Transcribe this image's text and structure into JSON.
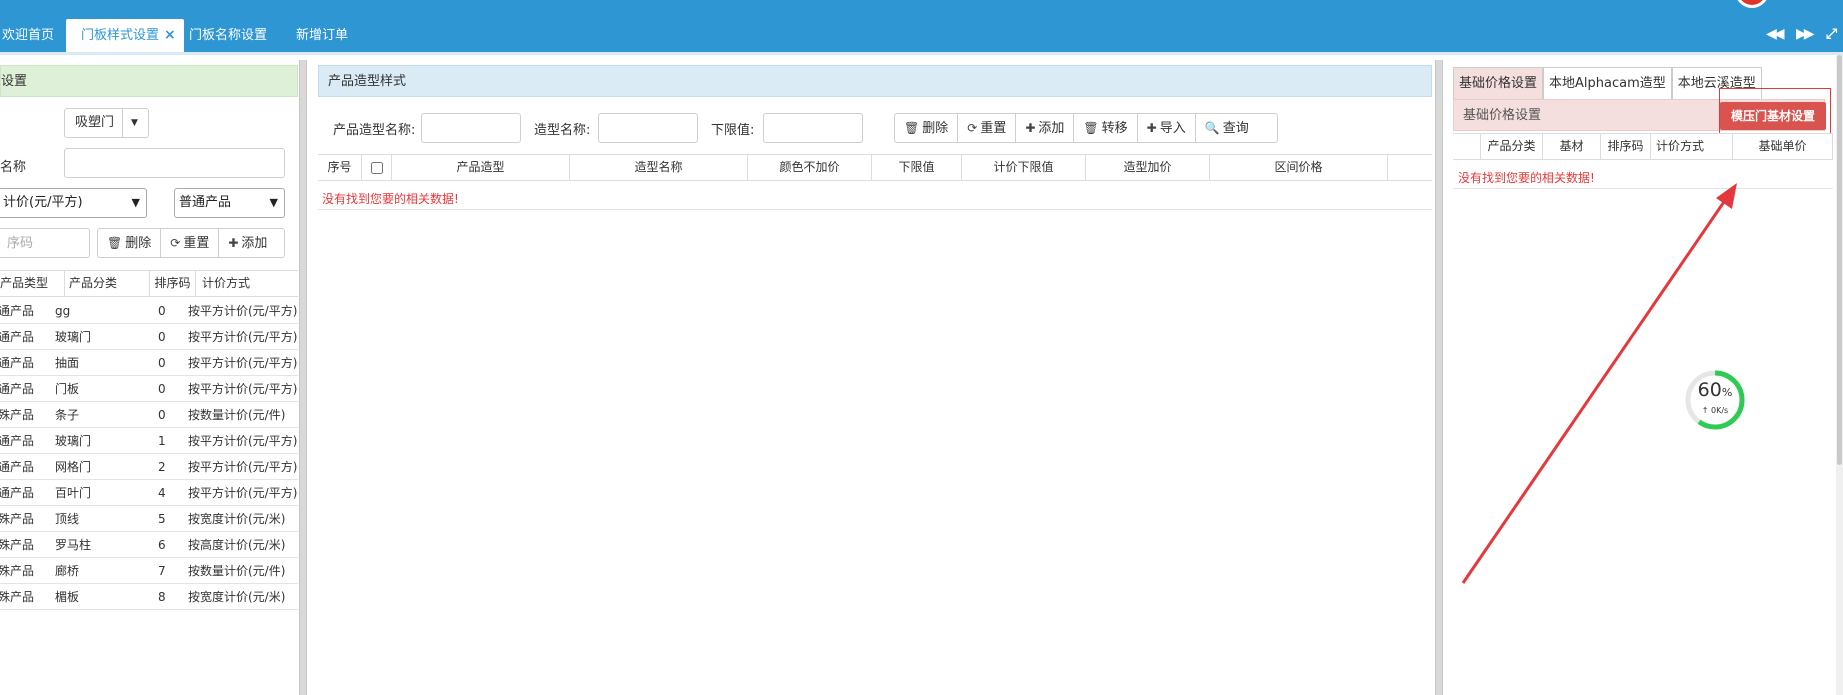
{
  "tabs": [
    {
      "label": "欢迎首页"
    },
    {
      "label": "门板样式设置",
      "active": true,
      "close": "×"
    },
    {
      "label": "门板名称设置"
    },
    {
      "label": "新增订单"
    }
  ],
  "nav_buttons": {
    "prev": "◀◀",
    "next": "▶▶",
    "fullscreen": "⤢"
  },
  "left": {
    "title": "设置",
    "door_type_select": "吸塑门",
    "name_label": "名称",
    "name_value": "",
    "pricing_select": "计价(元/平方)",
    "product_select": "普通产品",
    "sort_placeholder": "序码",
    "buttons": {
      "delete": "删除",
      "reset": "重置",
      "add": "添加"
    },
    "columns": [
      "产品类型",
      "产品分类",
      "排序码",
      "计价方式"
    ],
    "rows": [
      [
        "通产品",
        "gg",
        "0",
        "按平方计价(元/平方)"
      ],
      [
        "通产品",
        "玻璃门",
        "0",
        "按平方计价(元/平方)"
      ],
      [
        "通产品",
        "抽面",
        "0",
        "按平方计价(元/平方)"
      ],
      [
        "通产品",
        "门板",
        "0",
        "按平方计价(元/平方)"
      ],
      [
        "殊产品",
        "条子",
        "0",
        "按数量计价(元/件)"
      ],
      [
        "通产品",
        "玻璃门",
        "1",
        "按平方计价(元/平方)"
      ],
      [
        "通产品",
        "网格门",
        "2",
        "按平方计价(元/平方)"
      ],
      [
        "通产品",
        "百叶门",
        "4",
        "按平方计价(元/平方)"
      ],
      [
        "殊产品",
        "顶线",
        "5",
        "按宽度计价(元/米)"
      ],
      [
        "殊产品",
        "罗马柱",
        "6",
        "按高度计价(元/米)"
      ],
      [
        "殊产品",
        "廊桥",
        "7",
        "按数量计价(元/件)"
      ],
      [
        "殊产品",
        "楣板",
        "8",
        "按宽度计价(元/米)"
      ]
    ]
  },
  "middle": {
    "title": "产品造型样式",
    "filters": {
      "product_shape_label": "产品造型名称:",
      "shape_name_label": "造型名称:",
      "lower_limit_label": "下限值:"
    },
    "buttons": {
      "delete": "删除",
      "reset": "重置",
      "add": "添加",
      "move": "转移",
      "import": "导入",
      "query": "查询"
    },
    "columns": [
      "序号",
      "产品造型",
      "造型名称",
      "颜色不加价",
      "下限值",
      "计价下限值",
      "造型加价",
      "区间价格"
    ],
    "empty_message": "没有找到您要的相关数据!"
  },
  "right": {
    "tabs": [
      "基础价格设置",
      "本地Alphacam造型",
      "本地云溪造型"
    ],
    "title": "基础价格设置",
    "red_button": "模压门基材设置",
    "columns": [
      "产品分类",
      "基材",
      "排序码",
      "计价方式",
      "基础单价"
    ],
    "empty_message": "没有找到您要的相关数据!"
  },
  "network_gauge": {
    "percent": "60",
    "percent_unit": "%",
    "speed": "↑ 0K/s",
    "progress": 0.6
  },
  "colors": {
    "header": "#2f96d4",
    "danger": "#d9534f",
    "annotation": "#e4393c",
    "gauge": "#2ecc55"
  }
}
